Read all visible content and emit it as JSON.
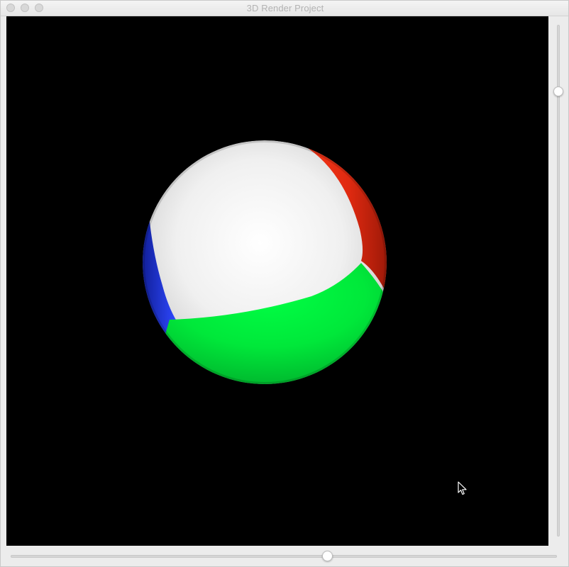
{
  "window": {
    "title": "3D Render Project"
  },
  "render": {
    "background_color": "#000000",
    "sphere_colors": {
      "white": "#f2f2f2",
      "green": "#00e83a",
      "red": "#e02a10",
      "blue": "#1a2fd0"
    }
  },
  "sliders": {
    "vertical_value": 0.13,
    "horizontal_value": 0.58
  },
  "icons": {
    "cursor": "mouse-pointer-icon"
  }
}
